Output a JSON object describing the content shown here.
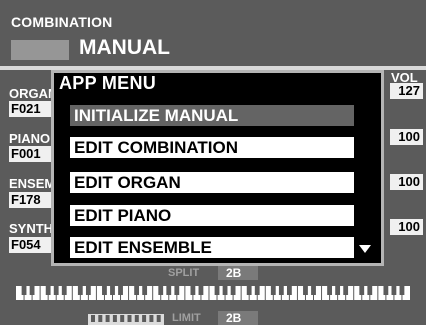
{
  "header": {
    "title": "COMBINATION",
    "combination_name": "MANUAL"
  },
  "volume_header": "VOL",
  "parts": [
    {
      "label": "ORGAN",
      "code": "F021",
      "vol": "127"
    },
    {
      "label": "PIANO",
      "code": "F001",
      "vol": "100"
    },
    {
      "label": "ENSEMBLE",
      "code": "F178",
      "vol": "100"
    },
    {
      "label": "SYNTH",
      "code": "F054",
      "vol": "100"
    }
  ],
  "menu": {
    "title": "APP MENU",
    "items": [
      {
        "label": "INITIALIZE MANUAL",
        "selected": true
      },
      {
        "label": "EDIT COMBINATION",
        "selected": false
      },
      {
        "label": "EDIT ORGAN",
        "selected": false
      },
      {
        "label": "EDIT PIANO",
        "selected": false
      },
      {
        "label": "EDIT ENSEMBLE",
        "selected": false
      }
    ],
    "scroll_icon": "triangle-down-icon"
  },
  "split": {
    "label": "SPLIT",
    "value": "2B"
  },
  "limit": {
    "label": "LIMIT",
    "value": "2B"
  },
  "colors": {
    "screen_bg": "#5b5b5b",
    "menu_bg": "#000000",
    "selected_item": "#646464"
  }
}
